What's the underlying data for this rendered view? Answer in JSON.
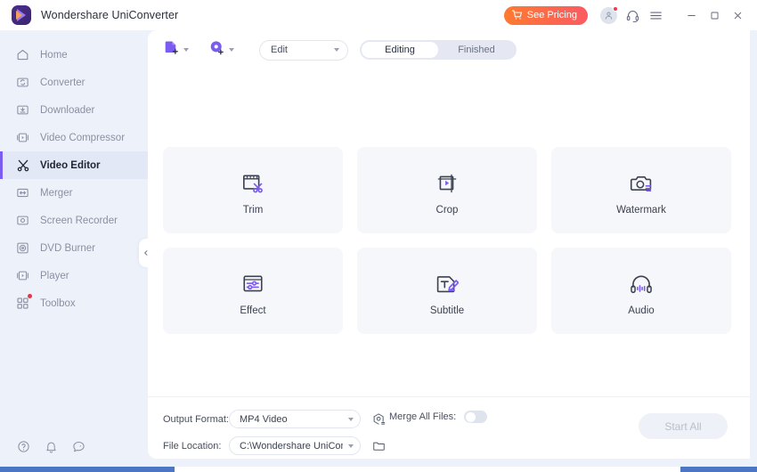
{
  "titlebar": {
    "app_title": "Wondershare UniConverter",
    "logo_icon": "play-logo-icon",
    "pricing_label": "See Pricing",
    "pricing_icon": "cart-icon",
    "account_icon": "user-avatar-icon",
    "support_icon": "headset-icon",
    "menu_icon": "hamburger-menu-icon",
    "minimize_icon": "minimize-icon",
    "maximize_icon": "maximize-icon",
    "close_icon": "close-icon",
    "notification_dot_color": "#f5364a",
    "pricing_gradient_from": "#ff7a2f",
    "pricing_gradient_to": "#fb5a63"
  },
  "sidebar": {
    "accent_color": "#7b5cf0",
    "items": [
      {
        "label": "Home",
        "icon": "home-icon",
        "active": false,
        "badge": false
      },
      {
        "label": "Converter",
        "icon": "converter-icon",
        "active": false,
        "badge": false
      },
      {
        "label": "Downloader",
        "icon": "downloader-icon",
        "active": false,
        "badge": false
      },
      {
        "label": "Video Compressor",
        "icon": "compressor-icon",
        "active": false,
        "badge": false
      },
      {
        "label": "Video Editor",
        "icon": "scissors-icon",
        "active": true,
        "badge": false
      },
      {
        "label": "Merger",
        "icon": "merger-icon",
        "active": false,
        "badge": false
      },
      {
        "label": "Screen Recorder",
        "icon": "screen-recorder-icon",
        "active": false,
        "badge": false
      },
      {
        "label": "DVD Burner",
        "icon": "dvd-burner-icon",
        "active": false,
        "badge": false
      },
      {
        "label": "Player",
        "icon": "player-icon",
        "active": false,
        "badge": false
      },
      {
        "label": "Toolbox",
        "icon": "toolbox-icon",
        "active": false,
        "badge": true
      }
    ],
    "bottom_icons": [
      {
        "name": "help-icon"
      },
      {
        "name": "notifications-bell-icon"
      },
      {
        "name": "feedback-icon"
      }
    ],
    "collapse_icon": "chevron-left-icon"
  },
  "toolbar": {
    "add_file_icon": "add-file-icon",
    "add_from_device_icon": "add-from-device-icon",
    "mode_select_value": "Edit",
    "segment": {
      "options": [
        "Editing",
        "Finished"
      ],
      "selected": "Editing"
    }
  },
  "cards": [
    {
      "label": "Trim",
      "icon": "trim-icon"
    },
    {
      "label": "Crop",
      "icon": "crop-icon"
    },
    {
      "label": "Watermark",
      "icon": "watermark-icon"
    },
    {
      "label": "Effect",
      "icon": "effect-icon"
    },
    {
      "label": "Subtitle",
      "icon": "subtitle-icon"
    },
    {
      "label": "Audio",
      "icon": "audio-icon"
    }
  ],
  "bottombar": {
    "output_format_label": "Output Format:",
    "output_format_value": "MP4 Video",
    "output_settings_icon": "output-settings-icon",
    "file_location_label": "File Location:",
    "file_location_value": "C:\\Wondershare UniConverter",
    "browse_folder_icon": "folder-icon",
    "merge_label": "Merge All Files:",
    "merge_enabled": false,
    "start_all_label": "Start All",
    "start_all_enabled": false
  }
}
